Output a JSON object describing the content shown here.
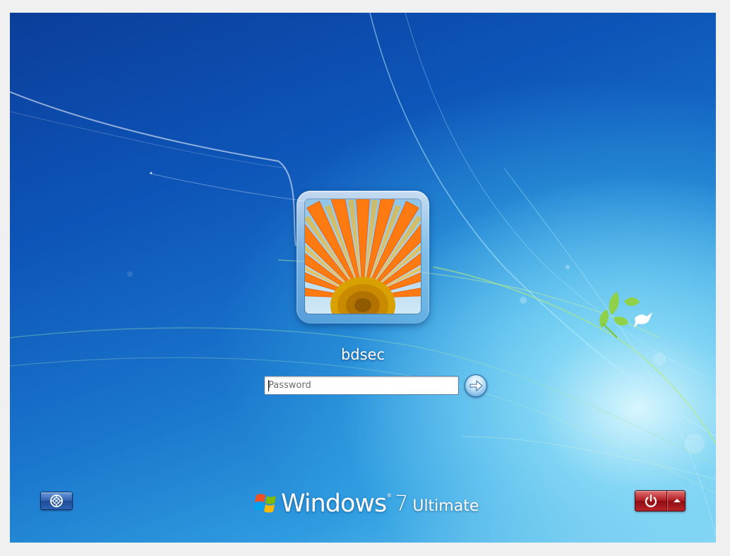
{
  "login": {
    "username": "bdsec",
    "password_placeholder": "Password",
    "password_value": ""
  },
  "branding": {
    "product": "Windows",
    "version": "7",
    "edition": "Ultimate",
    "registered_mark": "®"
  },
  "icons": {
    "avatar": "orange-flower-avatar",
    "submit": "arrow-right-icon",
    "ease_of_access": "ease-of-access-icon",
    "shutdown": "power-icon",
    "shutdown_options": "chevron-up-icon",
    "logo": "windows-flag-icon"
  },
  "colors": {
    "background_dark": "#0b3e9b",
    "background_light": "#7fd0f0",
    "shutdown_red": "#b01c22",
    "text": "#ffffff"
  }
}
